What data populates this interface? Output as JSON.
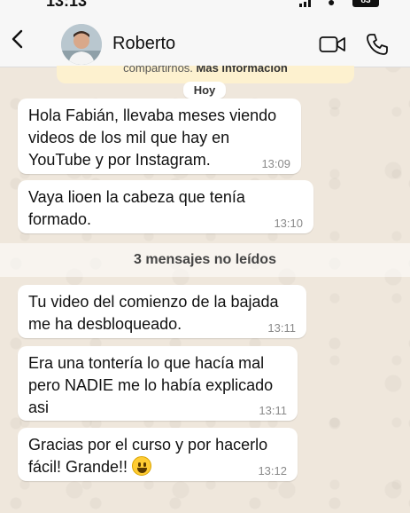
{
  "status_bar": {
    "time": "13:13",
    "battery": "83"
  },
  "header": {
    "contact_name": "Roberto"
  },
  "notice": {
    "text": "compartirnos.",
    "link": "Más información"
  },
  "date_chip": "Hoy",
  "messages": [
    {
      "text": "Hola Fabián, llevaba meses viendo videos de los mil que hay en YouTube y por Instagram.",
      "time": "13:09"
    },
    {
      "text": "Vaya lioen la cabeza que tenía formado.",
      "time": "13:10"
    },
    {
      "text": "Tu video del comienzo de la bajada me ha desbloqueado.",
      "time": "13:11"
    },
    {
      "text": "Era una tontería lo que hacía mal pero NADIE me lo había explicado asi",
      "time": "13:11"
    },
    {
      "text": "Gracias por el curso y por hacerlo fácil! Grande!!",
      "time": "13:12",
      "emoji": "grinning-face"
    }
  ],
  "unread_separator": "3 mensajes no leídos",
  "colors": {
    "wallpaper": "#efe7dc",
    "bubble": "#ffffff",
    "notice": "#fdf1cf",
    "accent": "#111111"
  }
}
